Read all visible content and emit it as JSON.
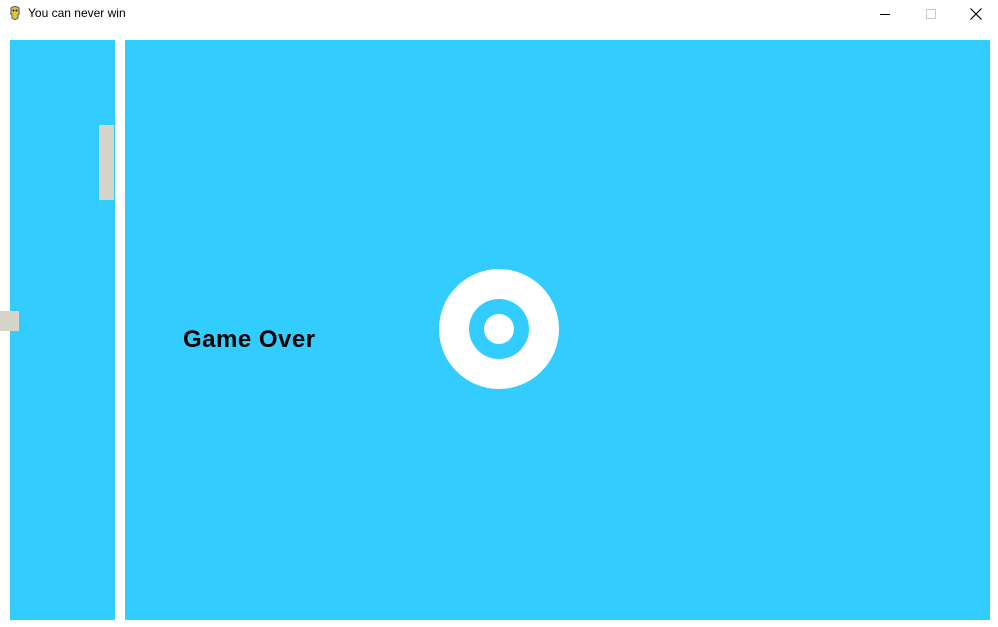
{
  "window": {
    "title": "You can never win",
    "icon": "pygame-snake-icon",
    "controls": {
      "minimize_icon": "minimize-icon",
      "maximize_icon": "maximize-icon",
      "close_icon": "close-icon"
    }
  },
  "game": {
    "message": "Game Over",
    "colors": {
      "field": "#33ccff",
      "divider": "#ffffff",
      "paddle": "#d4d4c8",
      "target_ring": "#ffffff",
      "text": "#000000"
    }
  }
}
